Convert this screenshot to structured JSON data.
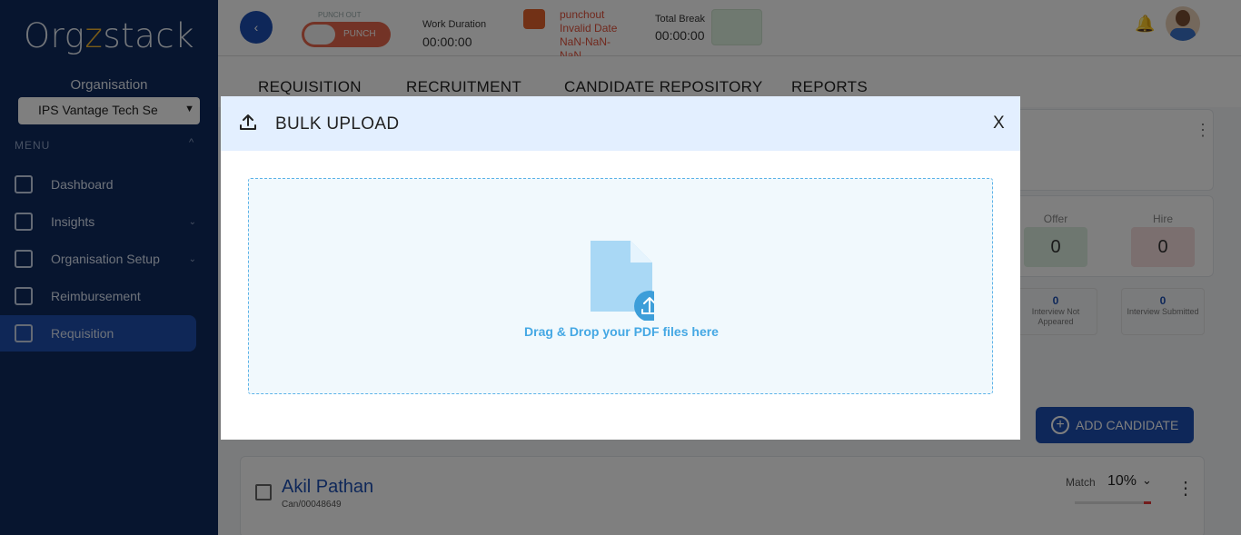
{
  "sidebar": {
    "logo": {
      "part1": "Org",
      "part2": "z",
      "part3": "stack"
    },
    "org_label": "Organisation",
    "org_selected": "IPS Vantage Tech Se",
    "menu_label": "MENU",
    "items": [
      {
        "label": "Dashboard",
        "icon": "dashboard-icon"
      },
      {
        "label": "Insights",
        "icon": "insights-icon"
      },
      {
        "label": "Organisation Setup",
        "icon": "org-setup-icon"
      },
      {
        "label": "Reimbursement",
        "icon": "reimbursement-icon"
      },
      {
        "label": "Requisition",
        "icon": "requisition-icon"
      }
    ]
  },
  "topbar": {
    "back_icon": "‹",
    "punch_label": "PUNCH OUT",
    "punch_toggle_text": "PUNCH",
    "work_duration_label": "Work Duration",
    "work_duration_value": "00:00:00",
    "punchout_text": "punchout Invalid Date NaN-NaN-NaN",
    "total_break_label": "Total Break",
    "total_break_value": "00:00:00"
  },
  "tabs": [
    "REQUISITION",
    "RECRUITMENT",
    "CANDIDATE REPOSITORY",
    "REPORTS"
  ],
  "stats": {
    "offer_label": "Offer",
    "offer_value": "0",
    "hire_label": "Hire",
    "hire_value": "0",
    "interview_not_appeared_value": "0",
    "interview_not_appeared_label": "Interview Not Appeared",
    "interview_submitted_value": "0",
    "interview_submitted_label": "Interview Submitted"
  },
  "add_candidate_label": "ADD CANDIDATE",
  "candidate": {
    "name": "Akil Pathan",
    "id": "Can/00048649",
    "match_label": "Match",
    "match_value": "10%",
    "match_fraction": 0.1
  },
  "modal": {
    "title": "BULK UPLOAD",
    "close_label": "X",
    "dropzone_text": "Drag & Drop your PDF files here"
  },
  "colors": {
    "sidebar_bg": "#0f2a5e",
    "accent": "#1d4fb3",
    "modal_header_bg": "#e3efff",
    "dropzone_border": "#5cb3e8",
    "dropzone_text": "#45a8e4"
  }
}
